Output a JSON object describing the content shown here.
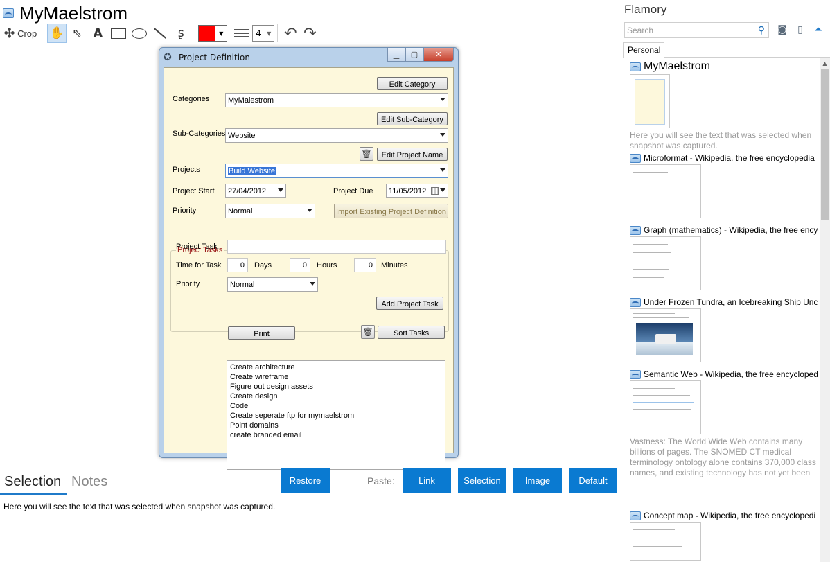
{
  "app": {
    "title": "MyMaelstrom"
  },
  "toolbar": {
    "crop_label": "Crop",
    "text_tool": "A",
    "color": "#ff0000",
    "line_width": "4"
  },
  "dialog": {
    "title": "Project Definition",
    "edit_category": "Edit Category",
    "categories_label": "Categories",
    "categories_value": "MyMalestrom",
    "edit_subcategory": "Edit Sub-Category",
    "subcategories_label": "Sub-Categories",
    "subcategories_value": "Website",
    "edit_project_name": "Edit Project Name",
    "projects_label": "Projects",
    "projects_value": "Build Website",
    "project_start_label": "Project Start",
    "project_start_value": "27/04/2012",
    "project_due_label": "Project Due",
    "project_due_value": "11/05/2012",
    "priority_label": "Priority",
    "priority_value": "Normal",
    "import_button": "Import Existing Project Definition",
    "tasks_group_title": "Project Tasks",
    "project_task_label": "Project Task",
    "time_for_task_label": "Time for Task",
    "days_value": "0",
    "days_label": "Days",
    "hours_value": "0",
    "hours_label": "Hours",
    "minutes_value": "0",
    "minutes_label": "Minutes",
    "task_priority_label": "Priority",
    "task_priority_value": "Normal",
    "add_task_button": "Add Project Task",
    "print_button": "Print",
    "sort_tasks_button": "Sort Tasks",
    "tasks": [
      "Create architecture",
      "Create wireframe",
      "Figure out design assets",
      "Create design",
      "Code",
      "Create seperate ftp for mymaelstrom",
      "Point domains",
      "create branded email"
    ]
  },
  "bottom": {
    "tab_selection": "Selection",
    "tab_notes": "Notes",
    "restore": "Restore",
    "paste_label": "Paste:",
    "paste_link": "Link",
    "paste_selection": "Selection",
    "paste_image": "Image",
    "paste_default": "Default",
    "selection_text": "Here you will see the text that was selected when snapshot was captured.",
    "button_color": "#0a7ad1"
  },
  "sidebar": {
    "title": "Flamory",
    "search_placeholder": "Search",
    "tab": "Personal",
    "items": [
      {
        "title": "MyMaelstrom",
        "desc": "Here you will see the text that was selected when snapshot was captured."
      },
      {
        "title": "Microformat - Wikipedia, the free encyclopedia"
      },
      {
        "title": "Graph (mathematics) - Wikipedia, the free ency"
      },
      {
        "title": "Under Frozen Tundra, an Icebreaking Ship Unco"
      },
      {
        "title": "Semantic Web - Wikipedia, the free encycloped",
        "desc": "Vastness: The World Wide Web contains many billions of pages. The SNOMED CT medical terminology ontology alone contains 370,000 class names, and existing technology has not yet been able to eliminate all semantically duplicated terms. Any automated reasoning system will have to deal with truly huge inputs."
      },
      {
        "title": "Concept map - Wikipedia, the free encyclopedi"
      }
    ]
  }
}
